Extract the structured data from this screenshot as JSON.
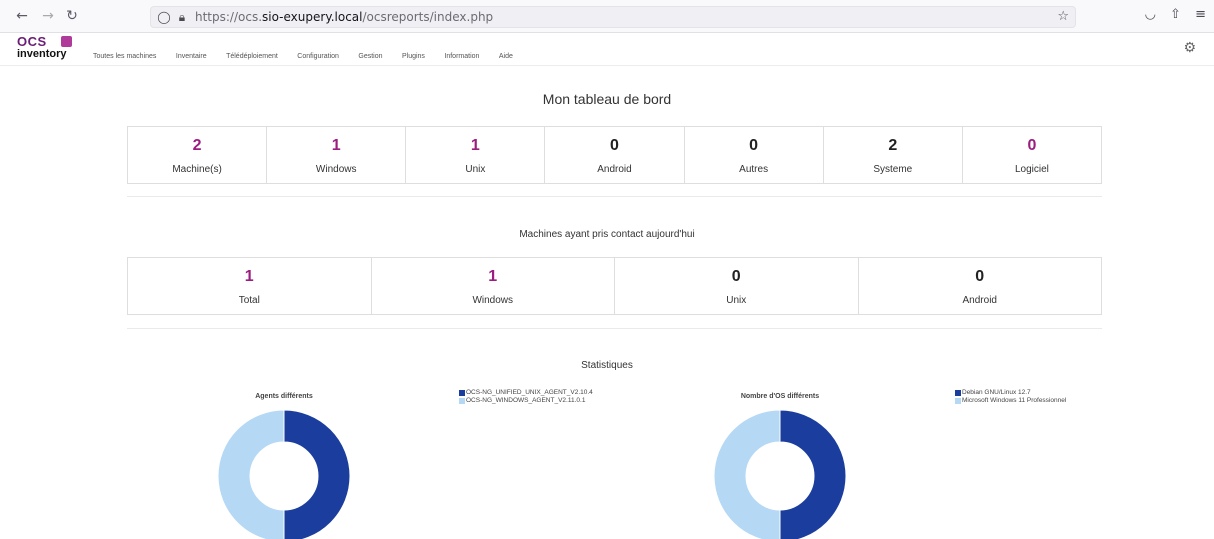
{
  "browser": {
    "url_prefix": "https://ocs.",
    "url_domain": "sio-exupery.local",
    "url_path": "/ocsreports/index.php"
  },
  "app": {
    "logo_top": "OCS",
    "logo_bottom": "inventory",
    "menu": [
      "Toutes les machines",
      "Inventaire",
      "Télédéploiement",
      "Configuration",
      "Gestion",
      "Plugins",
      "Information",
      "Aide"
    ]
  },
  "dashboard": {
    "title": "Mon tableau de bord",
    "stats": [
      {
        "value": "2",
        "label": "Machine(s)",
        "color": "#9b1d80"
      },
      {
        "value": "1",
        "label": "Windows",
        "color": "#9b1d80"
      },
      {
        "value": "1",
        "label": "Unix",
        "color": "#9b1d80"
      },
      {
        "value": "0",
        "label": "Android",
        "color": "#222222"
      },
      {
        "value": "0",
        "label": "Autres",
        "color": "#222222"
      },
      {
        "value": "2",
        "label": "Systeme",
        "color": "#222222"
      },
      {
        "value": "0",
        "label": "Logiciel",
        "color": "#9b1d80"
      }
    ]
  },
  "contact": {
    "title": "Machines ayant pris contact aujourd'hui",
    "stats": [
      {
        "value": "1",
        "label": "Total",
        "color": "#9b1d80"
      },
      {
        "value": "1",
        "label": "Windows",
        "color": "#9b1d80"
      },
      {
        "value": "0",
        "label": "Unix",
        "color": "#222222"
      },
      {
        "value": "0",
        "label": "Android",
        "color": "#222222"
      }
    ]
  },
  "statistics": {
    "title": "Statistiques"
  },
  "chart_data": [
    {
      "type": "pie",
      "title": "Agents différents",
      "categories": [
        "OCS-NG_UNIFIED_UNIX_AGENT_V2.10.4",
        "OCS-NG_WINDOWS_AGENT_V2.11.0.1"
      ],
      "values": [
        1,
        1
      ],
      "colors": [
        "#1a3d9e",
        "#b5d8f5"
      ]
    },
    {
      "type": "pie",
      "title": "Nombre d'OS différents",
      "categories": [
        "Debian GNU/Linux 12.7",
        "Microsoft Windows 11 Professionnel"
      ],
      "values": [
        1,
        1
      ],
      "colors": [
        "#1a3d9e",
        "#b5d8f5"
      ]
    }
  ]
}
